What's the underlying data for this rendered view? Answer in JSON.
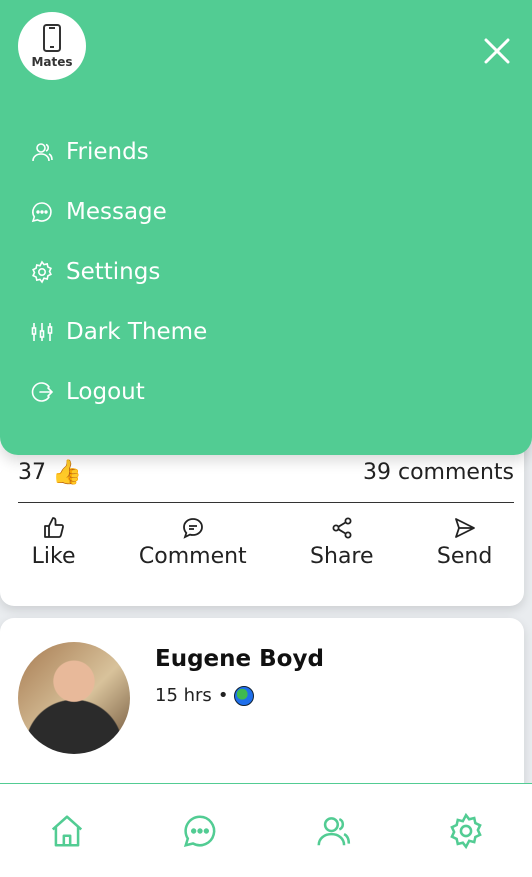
{
  "app": {
    "logo_text": "Mates"
  },
  "drawer": {
    "items": [
      {
        "label": "Friends",
        "icon": "friends-icon"
      },
      {
        "label": "Message",
        "icon": "message-icon"
      },
      {
        "label": "Settings",
        "icon": "settings-icon"
      },
      {
        "label": "Dark Theme",
        "icon": "dark-theme-icon"
      },
      {
        "label": "Logout",
        "icon": "logout-icon"
      }
    ]
  },
  "post": {
    "likes_count": "37",
    "comments_count": "39 comments",
    "actions": [
      "Like",
      "Comment",
      "Share",
      "Send"
    ]
  },
  "next_post": {
    "author": "Eugene Boyd",
    "time": "15 hrs"
  },
  "colors": {
    "accent": "#52cc93",
    "text": "#222222"
  }
}
